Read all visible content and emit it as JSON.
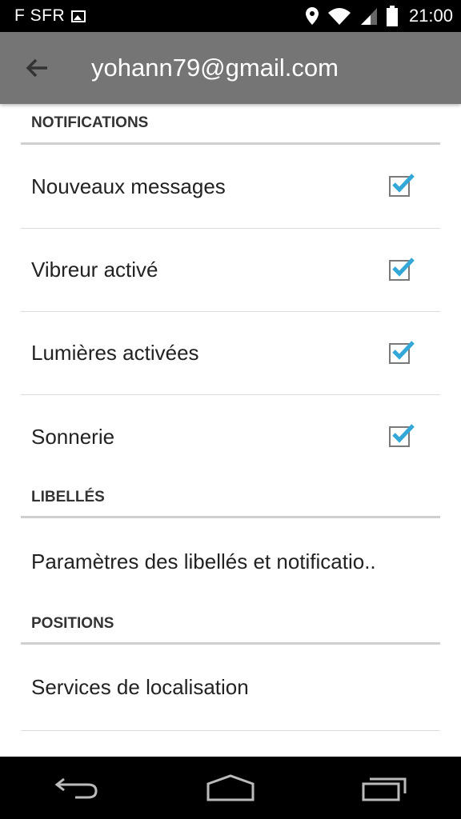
{
  "status_bar": {
    "carrier": "F SFR",
    "time": "21:00",
    "icons": [
      "image-notification-icon",
      "location-icon",
      "wifi-icon",
      "signal-icon",
      "battery-icon"
    ]
  },
  "action_bar": {
    "title": "yohann79@gmail.com",
    "back_icon": "arrow-left-icon",
    "background": "#757575"
  },
  "sections": {
    "notifications": {
      "header": "NOTIFICATIONS",
      "items": [
        {
          "label": "Nouveaux messages",
          "checked": true
        },
        {
          "label": "Vibreur activé",
          "checked": true
        },
        {
          "label": "Lumières activées",
          "checked": true
        },
        {
          "label": "Sonnerie",
          "checked": true
        }
      ]
    },
    "labels": {
      "header": "LIBELLÉS",
      "items": [
        {
          "label": "Paramètres des libellés et notificatio.."
        }
      ]
    },
    "positions": {
      "header": "POSITIONS",
      "items": [
        {
          "label": "Services de localisation"
        }
      ]
    }
  },
  "checkbox_color": "#33a7d8",
  "nav_bar": {
    "buttons": [
      "back-icon",
      "home-icon",
      "recent-apps-icon"
    ]
  }
}
